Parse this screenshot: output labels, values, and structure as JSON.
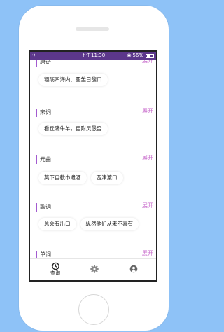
{
  "status_bar": {
    "time": "下午11:30",
    "battery_percent": "56%",
    "battery_level": 0.56
  },
  "sections": [
    {
      "title": "唐诗",
      "expand_label": "展开",
      "chips": [
        "粗砺四海内、亚雏日馥口"
      ]
    },
    {
      "title": "宋词",
      "expand_label": "展开",
      "chips": [
        "看丘陵牛羊，更附灵愚否"
      ]
    },
    {
      "title": "元曲",
      "expand_label": "展开",
      "chips": [
        "莫下自教巾遣酒",
        "西津渡口"
      ]
    },
    {
      "title": "歌词",
      "expand_label": "展开",
      "chips": [
        "总会有出口",
        "纵然他们从来不喜有"
      ]
    },
    {
      "title": "单词",
      "expand_label": "展开",
      "chips": []
    }
  ],
  "tab_bar": {
    "query_label": "查询",
    "query_icon": "history-icon",
    "settings_icon": "gear-icon",
    "profile_icon": "user-circle-icon"
  },
  "colors": {
    "status_bar": "#5c378b",
    "accent_bar": "#a35bd0",
    "expand_text": "#c86ccc",
    "background": "#8ec2f7"
  }
}
